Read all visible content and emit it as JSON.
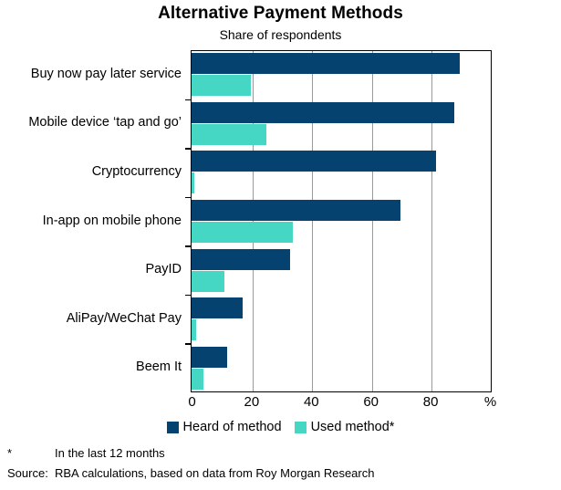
{
  "chart_data": {
    "type": "bar",
    "orientation": "horizontal",
    "title": "Alternative Payment Methods",
    "subtitle": "Share of respondents",
    "xlabel": "%",
    "ylabel": "",
    "xlim": [
      0,
      100
    ],
    "xticks": [
      0,
      20,
      40,
      60,
      80,
      100
    ],
    "xticklabels": [
      "0",
      "20",
      "40",
      "60",
      "80",
      "%"
    ],
    "grid": true,
    "grid_axis": "x",
    "legend_position": "bottom-center",
    "categories": [
      "Buy now pay later service",
      "Mobile device ‘tap and go’",
      "Cryptocurrency",
      "In-app on mobile phone",
      "PayID",
      "AliPay/WeChat Pay",
      "Beem It"
    ],
    "series": [
      {
        "name": "Heard of method",
        "color": "#05426f",
        "values": [
          90,
          88,
          82,
          70,
          33,
          17,
          12
        ]
      },
      {
        "name": "Used method*",
        "color": "#45d6c4",
        "values": [
          20,
          25,
          1,
          34,
          11,
          1.5,
          4
        ]
      }
    ]
  },
  "header": {
    "title": "Alternative Payment Methods",
    "subtitle": "Share of respondents"
  },
  "axis": {
    "x_unit_label": "%",
    "xticklabels": [
      "0",
      "20",
      "40",
      "60",
      "80",
      "%"
    ]
  },
  "legend": {
    "items": [
      {
        "label": "Heard of method",
        "color": "#05426f"
      },
      {
        "label": "Used method*",
        "color": "#45d6c4"
      }
    ]
  },
  "footnotes": [
    {
      "marker": "*",
      "text": "In the last 12 months"
    },
    {
      "marker": "Source:",
      "text": "RBA calculations, based on data from Roy Morgan Research"
    }
  ],
  "colors": {
    "heard": "#05426f",
    "used": "#45d6c4",
    "grid": "#9a9a9a",
    "frame": "#000000",
    "background": "#ffffff"
  }
}
